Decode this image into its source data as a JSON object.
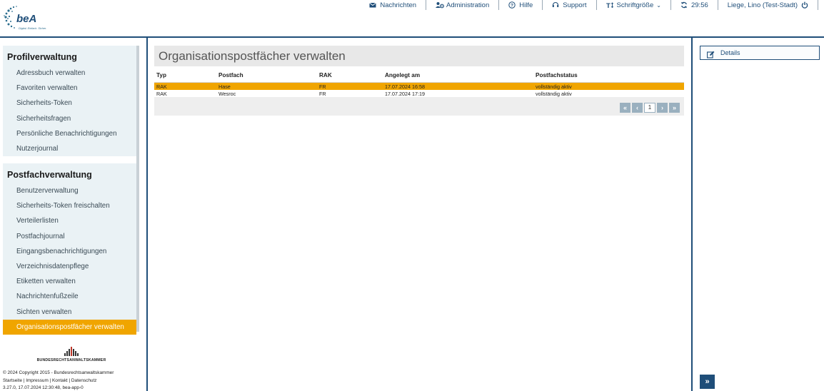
{
  "header": {
    "logo_text": "beA",
    "logo_tagline": "Digital. Einfach. Sicher.",
    "nav": [
      {
        "label": "Nachrichten",
        "icon": "envelope-icon"
      },
      {
        "label": "Administration",
        "icon": "users-cog-icon"
      },
      {
        "label": "Hilfe",
        "icon": "question-circle-icon"
      },
      {
        "label": "Support",
        "icon": "headset-icon"
      },
      {
        "label": "Schriftgröße",
        "icon": "text-size-icon"
      },
      {
        "label": "29:56",
        "icon": "refresh-icon"
      },
      {
        "label": "Liege, Lino (Test-Stadt)",
        "icon": "power-icon"
      }
    ]
  },
  "sidebar": {
    "profil": {
      "title": "Profilverwaltung",
      "items": [
        "Adressbuch verwalten",
        "Favoriten verwalten",
        "Sicherheits-Token",
        "Sicherheitsfragen",
        "Persönliche Benachrichtigungen",
        "Nutzerjournal"
      ]
    },
    "postfach": {
      "title": "Postfachverwaltung",
      "items": [
        "Benutzerverwaltung",
        "Sicherheits-Token freischalten",
        "Verteilerlisten",
        "Postfachjournal",
        "Eingangsbenachrichtigungen",
        "Verzeichnisdatenpflege",
        "Etiketten verwalten",
        "Nachrichtenfußzeile",
        "Sichten verwalten",
        "Organisationspostfächer verwalten"
      ],
      "active_index": 9
    },
    "brak_name": "BUNDESRECHTSANWALTSKAMMER",
    "footer": {
      "copyright": "© 2024 Copyright 2015 - Bundesrechtsanwaltskammer",
      "links": "Startseite | Impressum | Kontakt | Datenschutz",
      "version": "3.27.0, 17.07.2024 12:30:48, bea-app-0"
    }
  },
  "main": {
    "title": "Organisationspostfächer verwalten",
    "columns": [
      "Typ",
      "Postfach",
      "RAK",
      "Angelegt am",
      "Postfachstatus"
    ],
    "rows": [
      {
        "typ": "RAK",
        "postfach": "Hase",
        "rak": "FR",
        "angelegt": "17.07.2024 16:58",
        "status": "vollständig aktiv",
        "selected": true
      },
      {
        "typ": "RAK",
        "postfach": "Wesroc",
        "rak": "FR",
        "angelegt": "17.07.2024 17:19",
        "status": "vollständig aktiv",
        "selected": false
      }
    ],
    "pager": {
      "first": "«",
      "prev": "‹",
      "page": "1",
      "next": "›",
      "last": "»"
    }
  },
  "right": {
    "details_label": "Details",
    "expand_label": "»"
  },
  "colors": {
    "navy": "#1f4e79",
    "accent": "#f0a500"
  }
}
